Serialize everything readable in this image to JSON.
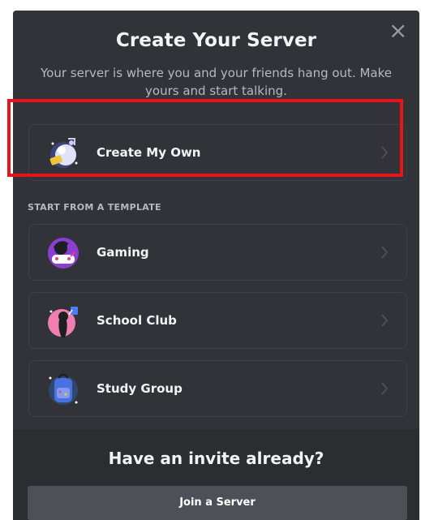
{
  "modal": {
    "title": "Create Your Server",
    "subtitle": "Your server is where you and your friends hang out. Make yours and start talking.",
    "close_icon": "close-icon"
  },
  "create_own": {
    "label": "Create My Own",
    "icon": "create-server-icon"
  },
  "templates": {
    "section_label": "START FROM A TEMPLATE",
    "items": [
      {
        "label": "Gaming",
        "icon": "gaming-icon"
      },
      {
        "label": "School Club",
        "icon": "school-club-icon"
      },
      {
        "label": "Study Group",
        "icon": "study-group-icon"
      }
    ]
  },
  "footer": {
    "title": "Have an invite already?",
    "join_label": "Join a Server"
  },
  "colors": {
    "modal_bg": "#313338",
    "footer_bg": "#2b2d31",
    "highlight": "#e8141b",
    "button_bg": "#4e5058"
  }
}
